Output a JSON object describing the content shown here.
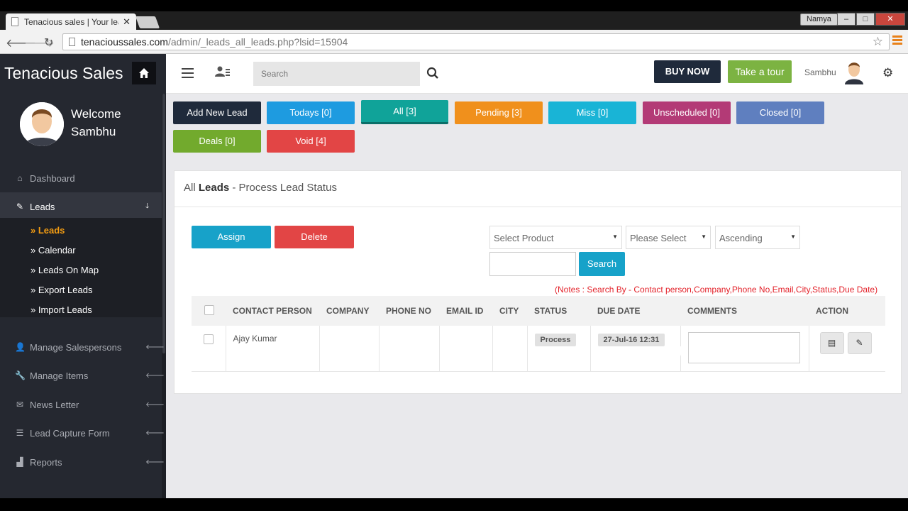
{
  "browser": {
    "tab_title": "Tenacious sales | Your lea",
    "tab_close": "✕",
    "user_chip": "Namya",
    "url_host": "tenacioussales.com",
    "url_path": "/admin/_leads_all_leads.php?lsid=15904"
  },
  "header": {
    "brand": "Tenacious Sales",
    "search_placeholder": "Search",
    "buy_now": "BUY NOW",
    "take_tour": "Take a tour",
    "user_name": "Sambhu"
  },
  "sidebar": {
    "welcome_line1": "Welcome",
    "welcome_line2": "Sambhu",
    "items": [
      {
        "label": "Dashboard",
        "icon": "home-icon"
      },
      {
        "label": "Leads",
        "icon": "wand-icon"
      },
      {
        "label": "Manage Salespersons",
        "icon": "users-icon"
      },
      {
        "label": "Manage Items",
        "icon": "wrench-icon"
      },
      {
        "label": "News Letter",
        "icon": "envelope-icon"
      },
      {
        "label": "Lead Capture Form",
        "icon": "list-icon"
      },
      {
        "label": "Reports",
        "icon": "chart-icon"
      }
    ],
    "submenu": [
      "» Leads",
      "» Calendar",
      "» Leads On Map",
      "» Export Leads",
      "» Import Leads"
    ]
  },
  "filters": [
    {
      "label": "Add New Lead",
      "color": "#1f2a3b"
    },
    {
      "label": "Todays [0]",
      "color": "#1e9be0"
    },
    {
      "label": "All [3]",
      "color": "#10a399"
    },
    {
      "label": "Pending [3]",
      "color": "#f0901c"
    },
    {
      "label": "Miss [0]",
      "color": "#19b4d6"
    },
    {
      "label": "Unscheduled [0]",
      "color": "#b33a76"
    },
    {
      "label": "Closed [0]",
      "color": "#5f7fbf"
    },
    {
      "label": "Deals [0]",
      "color": "#72aa2d"
    },
    {
      "label": "Void [4]",
      "color": "#e24545"
    }
  ],
  "panel": {
    "title_prefix": "All ",
    "title_bold": "Leads",
    "title_suffix": " - Process Lead Status",
    "assign": "Assign",
    "delete": "Delete",
    "select_product": "Select Product",
    "please_select": "Please Select",
    "order": "Ascending",
    "search": "Search",
    "notes": "(Notes : Search By - Contact person,Company,Phone No,Email,City,Status,Due Date)"
  },
  "table": {
    "columns": [
      "CONTACT PERSON",
      "COMPANY",
      "PHONE NO",
      "EMAIL ID",
      "CITY",
      "STATUS",
      "DUE DATE",
      "COMMENTS",
      "ACTION"
    ],
    "rows": [
      {
        "contact": "Ajay Kumar",
        "company": "",
        "phone": "",
        "email": "",
        "city": "",
        "status": "Process",
        "due": "27-Jul-16 12:31",
        "comment": ""
      }
    ]
  }
}
